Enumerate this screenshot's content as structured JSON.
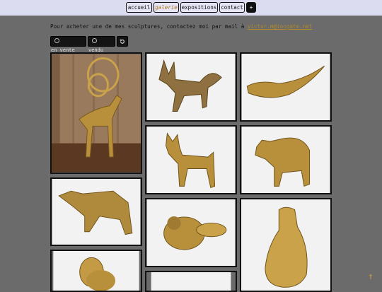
{
  "nav": {
    "accueil": "accueil",
    "galerie": "galerie",
    "expositions": "expositions",
    "contact": "contact",
    "plus": "+"
  },
  "intro": {
    "text": "Pour acheter une de mes sculptures, contactez moi par mail à ",
    "email": "victor.m@iocgate.net"
  },
  "filters": {
    "en_vente": "en_vente",
    "vendu": "vendu",
    "reset_icon": "reset-icon"
  },
  "gallery": {
    "photos": [
      {
        "subject": "bronze goat with spiral horns on wood"
      },
      {
        "subject": "bronze jackal with curled tail"
      },
      {
        "subject": "bronze fish with long curved tail"
      },
      {
        "subject": "bronze dog standing"
      },
      {
        "subject": "bronze bear standing"
      },
      {
        "subject": "bronze bull"
      },
      {
        "subject": "bronze curled animal"
      },
      {
        "subject": "bronze pear-shaped figure"
      },
      {
        "subject": "bronze mouse"
      },
      {
        "subject": "bronze sculpture"
      }
    ]
  },
  "scroll_icon": "arrow-up-icon",
  "colors": {
    "background": "#6b6b6b",
    "topbar": "#dcdcf0",
    "accent": "#b08a2a",
    "bronze": "#b8903c"
  }
}
